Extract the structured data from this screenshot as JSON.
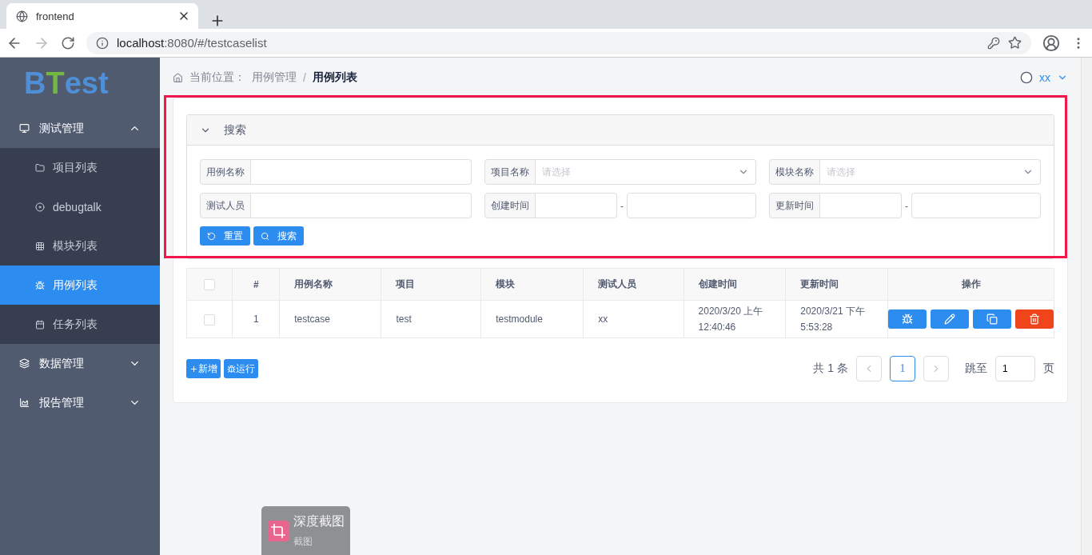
{
  "browser": {
    "tab_title": "frontend",
    "url_host": "localhost",
    "url_rest": ":8080/#/testcaselist"
  },
  "sidebar": {
    "logo": [
      {
        "text": "B",
        "color": "#4f8fd8"
      },
      {
        "text": "T",
        "color": "#74b843"
      },
      {
        "text": "est",
        "color": "#4f8fd8"
      }
    ],
    "menu": [
      {
        "label": "测试管理",
        "expanded": true,
        "children": [
          {
            "label": "项目列表",
            "selected": false
          },
          {
            "label": "debugtalk",
            "selected": false
          },
          {
            "label": "模块列表",
            "selected": false
          },
          {
            "label": "用例列表",
            "selected": true
          },
          {
            "label": "任务列表",
            "selected": false
          }
        ]
      },
      {
        "label": "数据管理",
        "expanded": false
      },
      {
        "label": "报告管理",
        "expanded": false
      }
    ]
  },
  "breadcrumb": {
    "prefix": "当前位置：",
    "items": [
      "用例管理",
      "用例列表"
    ],
    "separator": "/"
  },
  "user": {
    "name": "xx"
  },
  "search": {
    "title": "搜索",
    "expanded": true,
    "fields": [
      {
        "kind": "text",
        "label": "用例名称"
      },
      {
        "kind": "select",
        "label": "项目名称",
        "placeholder": "请选择"
      },
      {
        "kind": "select",
        "label": "模块名称",
        "placeholder": "请选择"
      },
      {
        "kind": "text",
        "label": "测试人员"
      },
      {
        "kind": "range",
        "label": "创建时间",
        "separator": "-"
      },
      {
        "kind": "range",
        "label": "更新时间",
        "separator": "-"
      }
    ],
    "buttons": [
      {
        "label": "重置"
      },
      {
        "label": "搜索"
      }
    ]
  },
  "table": {
    "columns": [
      "#",
      "用例名称",
      "项目",
      "模块",
      "测试人员",
      "创建时间",
      "更新时间",
      "操作"
    ],
    "all_checked": false,
    "rows": [
      {
        "checked": false,
        "cells": [
          "1",
          "testcase",
          "test",
          "testmodule",
          "xx",
          "2020/3/20 上午12:40:46",
          "2020/3/21 下午5:53:28"
        ],
        "actions": [
          {
            "kind": "run"
          },
          {
            "kind": "edit"
          },
          {
            "kind": "copy"
          },
          {
            "kind": "delete"
          }
        ]
      }
    ]
  },
  "footer_buttons": [
    {
      "label": "新增"
    },
    {
      "label": "运行"
    }
  ],
  "pagination": {
    "total": "共 1 条",
    "pages": [
      {
        "label": "1",
        "selected": true
      }
    ],
    "jump_label": "跳至",
    "jump_value": "1",
    "suffix": "页"
  },
  "notification": {
    "title": "深度截图",
    "subtitle": "截图"
  }
}
